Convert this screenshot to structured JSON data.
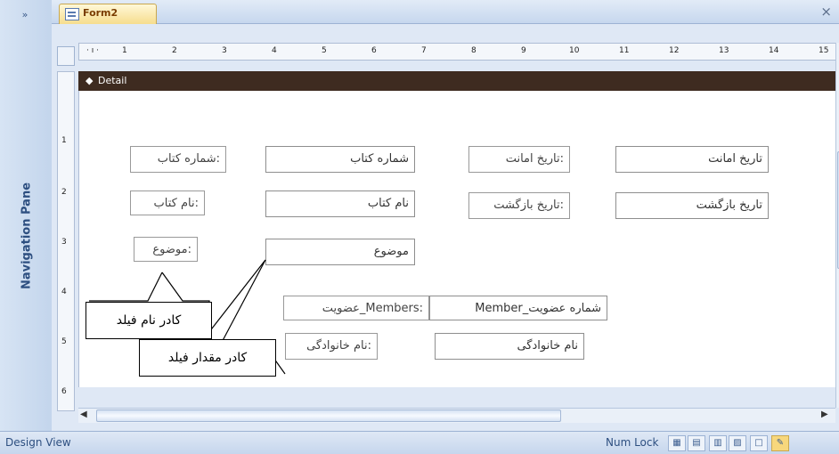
{
  "nav_pane": {
    "toggle": "»",
    "label": "Navigation Pane"
  },
  "tab": {
    "title": "Form2",
    "close": "×"
  },
  "ruler": {
    "ticks": [
      "1",
      "2",
      "3",
      "4",
      "5",
      "6",
      "7",
      "8",
      "9",
      "10",
      "11",
      "12",
      "13",
      "14",
      "15"
    ],
    "vticks": [
      "1",
      "2",
      "3",
      "4",
      "5",
      "6"
    ]
  },
  "section": {
    "name": "Detail"
  },
  "controls": {
    "book_number_label": "شماره کتاب:",
    "book_number_field": "شماره کتاب",
    "loan_date_label": "تاریخ امانت:",
    "loan_date_field": "تاریخ امانت",
    "book_name_label": "نام کتاب:",
    "book_name_field": "نام کتاب",
    "return_date_label": "تاریخ بازگشت:",
    "return_date_field": "تاریخ بازگشت",
    "subject_label": "موضوع:",
    "subject_field": "موضوع",
    "member_number_label": "عضویت_Members:",
    "member_number_field": "Member_شماره عضویت",
    "family_label": "نام خانوادگی:",
    "family_field": "نام خانوادگی"
  },
  "callouts": {
    "field_name_box": "کادر نام فیلد",
    "field_value_box": "کادر مقدار فیلد"
  },
  "status": {
    "mode": "Design View",
    "numlock": "Num Lock"
  },
  "view_buttons": [
    "form-view",
    "datasheet-view",
    "pivot-table",
    "pivot-chart",
    "layout-view",
    "design-view"
  ]
}
